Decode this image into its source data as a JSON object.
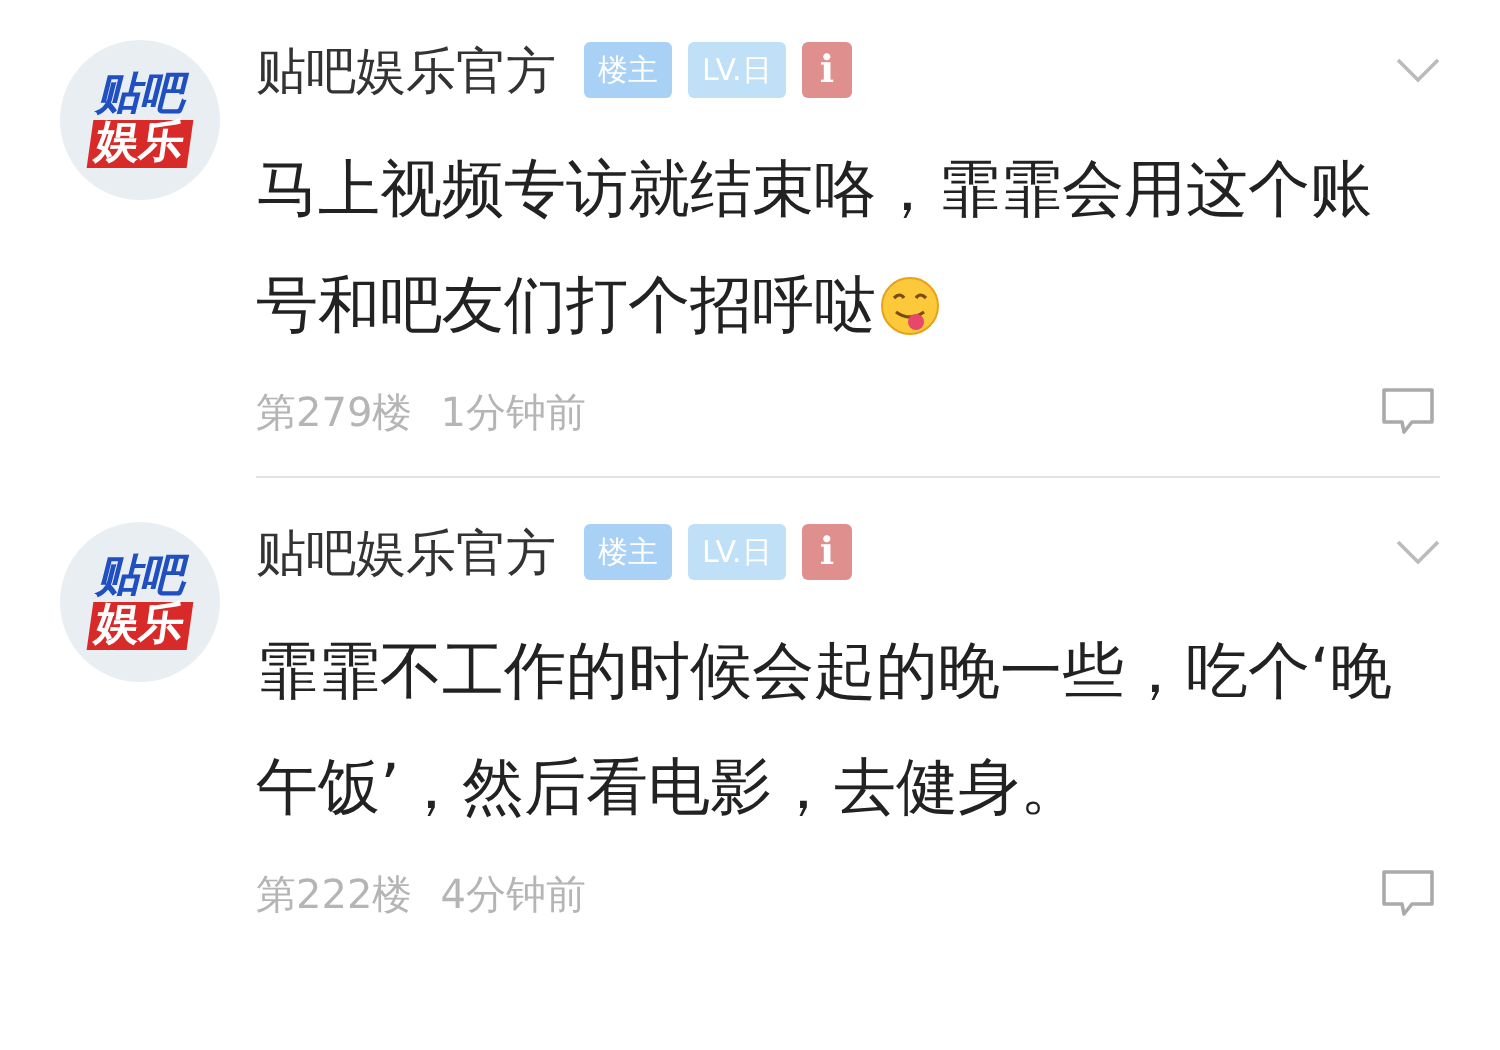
{
  "posts": [
    {
      "avatar": [
        "贴吧",
        "娱乐"
      ],
      "author": "贴吧娱乐官方",
      "badges": [
        {
          "kind": "owner",
          "text": "楼主"
        },
        {
          "kind": "level",
          "text": "LV.日"
        },
        {
          "kind": "info",
          "text": "i"
        }
      ],
      "content": "马上视频专访就结束咯，霏霏会用这个账号和吧友们打个招呼哒",
      "emoji": true,
      "floor": "第279楼",
      "time": "1分钟前"
    },
    {
      "avatar": [
        "贴吧",
        "娱乐"
      ],
      "author": "贴吧娱乐官方",
      "badges": [
        {
          "kind": "owner",
          "text": "楼主"
        },
        {
          "kind": "level",
          "text": "LV.日"
        },
        {
          "kind": "info",
          "text": "i"
        }
      ],
      "content": "霏霏不工作的时候会起的晚一些，吃个‘晚午饭’，然后看电影，去健身。",
      "emoji": false,
      "floor": "第222楼",
      "time": "4分钟前"
    }
  ]
}
